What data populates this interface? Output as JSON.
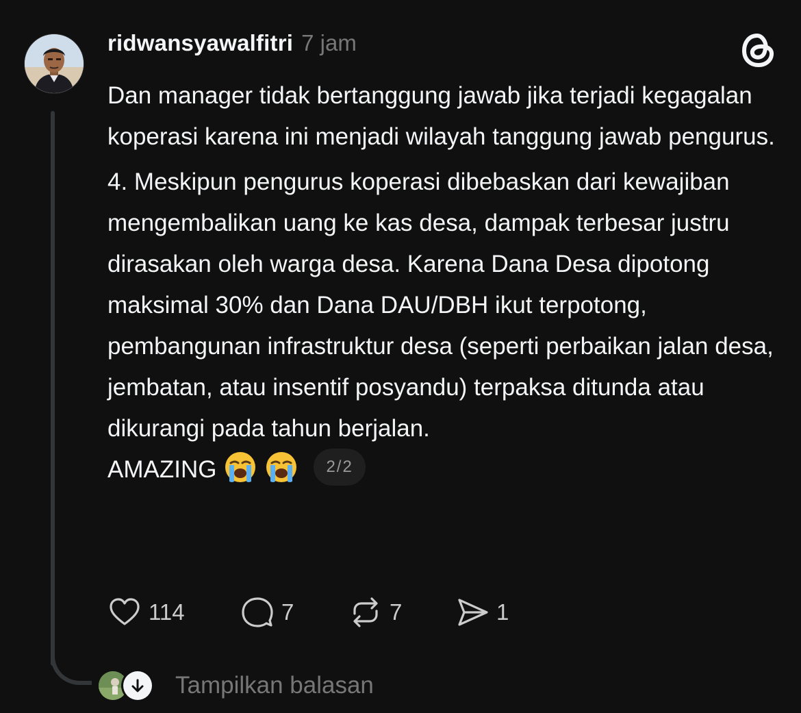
{
  "post": {
    "username": "ridwansyawalfitri",
    "time": "7 jam",
    "paragraphs": [
      "Dan manager tidak bertanggung jawab jika terjadi kegagalan koperasi karena ini menjadi wilayah tanggung jawab pengurus.",
      "4. Meskipun pengurus koperasi dibebaskan dari kewajiban mengembalikan uang ke kas desa, dampak terbesar justru dirasakan oleh warga desa. Karena Dana Desa dipotong maksimal 30% dan Dana DAU/DBH ikut terpotong, pembangunan infrastruktur desa (seperti perbaikan jalan desa, jembatan, atau insentif posyandu) terpaksa ditunda atau dikurangi pada tahun berjalan."
    ],
    "closing_text": "AMAZING",
    "emojis": [
      "loudly-crying-face",
      "loudly-crying-face"
    ],
    "page_indicator": "2/2"
  },
  "actions": {
    "likes": "114",
    "replies": "7",
    "reposts": "7",
    "shares": "1"
  },
  "footer": {
    "show_replies_label": "Tampilkan balasan"
  },
  "icons": {
    "logo": "threads-logo-icon",
    "like": "heart-icon",
    "reply": "speech-bubble-icon",
    "repost": "repost-icon",
    "share": "send-icon",
    "expand": "arrow-down-icon"
  },
  "colors": {
    "background": "#101010",
    "text": "#f3f5f7",
    "muted": "#777777",
    "thread_line": "#333638"
  }
}
